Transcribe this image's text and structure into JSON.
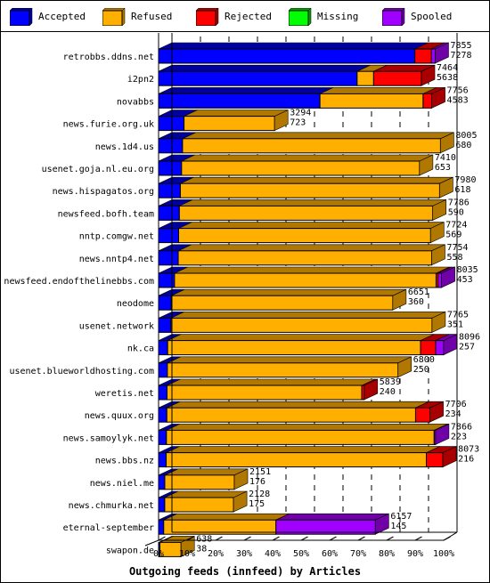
{
  "chart_data": {
    "type": "bar",
    "orientation": "horizontal-stacked",
    "title": "",
    "xlabel": "Outgoing feeds (innfeed) by Articles",
    "ylabel": "",
    "xlim": [
      0,
      100
    ],
    "x_unit": "%",
    "x_ticks": [
      "0%",
      "10%",
      "20%",
      "30%",
      "40%",
      "50%",
      "60%",
      "70%",
      "80%",
      "90%",
      "100%"
    ],
    "legend_position": "top",
    "legend": [
      {
        "name": "Accepted",
        "color": "#0000ff",
        "shade": "#0000a0"
      },
      {
        "name": "Refused",
        "color": "#ffaf00",
        "shade": "#b07800"
      },
      {
        "name": "Rejected",
        "color": "#ff0000",
        "shade": "#a80000"
      },
      {
        "name": "Missing",
        "color": "#00ff00",
        "shade": "#00a000"
      },
      {
        "name": "Spooled",
        "color": "#a000ff",
        "shade": "#7000a8"
      }
    ],
    "max_total": 8096,
    "categories": [
      "retrobbs.ddns.net",
      "i2pn2",
      "novabbs",
      "news.furie.org.uk",
      "news.1d4.us",
      "usenet.goja.nl.eu.org",
      "news.hispagatos.org",
      "newsfeed.bofh.team",
      "nntp.comgw.net",
      "news.nntp4.net",
      "newsfeed.endofthelinebbs.com",
      "neodome",
      "usenet.network",
      "nk.ca",
      "usenet.blueworldhosting.com",
      "weretis.net",
      "news.quux.org",
      "news.samoylyk.net",
      "news.bbs.nz",
      "news.niel.me",
      "news.chmurka.net",
      "eternal-september",
      "swapon.de"
    ],
    "totals": [
      7855,
      7464,
      7756,
      3294,
      8005,
      7410,
      7980,
      7786,
      7724,
      7754,
      8035,
      6651,
      7765,
      8096,
      6800,
      5839,
      7706,
      7866,
      8073,
      2151,
      2128,
      6157,
      638
    ],
    "series": [
      {
        "name": "Accepted",
        "values": [
          7278,
          5638,
          4583,
          723,
          680,
          653,
          618,
          590,
          569,
          558,
          453,
          360,
          351,
          257,
          250,
          240,
          234,
          223,
          216,
          176,
          175,
          145,
          38
        ]
      },
      {
        "name": "Refused",
        "values": [
          0,
          469,
          2929,
          2571,
          7325,
          6757,
          7362,
          7196,
          7155,
          7196,
          7427,
          6291,
          7414,
          7182,
          6550,
          5531,
          7064,
          7603,
          7387,
          1975,
          1953,
          3188,
          600
        ]
      },
      {
        "name": "Rejected",
        "values": [
          469,
          1357,
          244,
          0,
          0,
          0,
          0,
          0,
          0,
          0,
          55,
          0,
          0,
          429,
          0,
          68,
          408,
          0,
          470,
          0,
          0,
          0,
          0
        ]
      },
      {
        "name": "Missing",
        "values": [
          0,
          0,
          0,
          0,
          0,
          0,
          0,
          0,
          0,
          0,
          0,
          0,
          0,
          0,
          0,
          0,
          0,
          0,
          0,
          0,
          0,
          0,
          0
        ]
      },
      {
        "name": "Spooled",
        "values": [
          108,
          0,
          0,
          0,
          0,
          0,
          0,
          0,
          0,
          0,
          100,
          0,
          0,
          228,
          0,
          0,
          0,
          40,
          0,
          0,
          0,
          2824,
          0
        ]
      }
    ]
  }
}
